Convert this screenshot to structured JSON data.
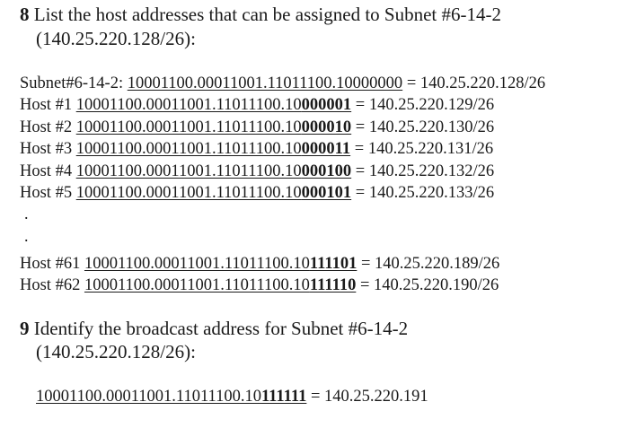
{
  "q8": {
    "number": "8",
    "title": " List the host addresses that can be assigned to Subnet #6-14-2",
    "subtitle": "(140.25.220.128/26):"
  },
  "subnet_line": {
    "label": "Subnet#6-14-2: ",
    "binary_plain": "10001100.00011001.11011100.10000000",
    "binary_bold": "",
    "result": " = 140.25.220.128/26"
  },
  "hosts": [
    {
      "label": "Host #1 ",
      "binary_plain": "10001100.00011001.11011100.10",
      "binary_bold": "000001",
      "result": " = 140.25.220.129/26"
    },
    {
      "label": "Host #2 ",
      "binary_plain": "10001100.00011001.11011100.10",
      "binary_bold": "000010",
      "result": " = 140.25.220.130/26"
    },
    {
      "label": "Host #3 ",
      "binary_plain": "10001100.00011001.11011100.10",
      "binary_bold": "000011",
      "result": " = 140.25.220.131/26"
    },
    {
      "label": "Host #4 ",
      "binary_plain": "10001100.00011001.11011100.10",
      "binary_bold": "000100",
      "result": " = 140.25.220.132/26"
    },
    {
      "label": "Host #5 ",
      "binary_plain": "10001100.00011001.11011100.10",
      "binary_bold": "000101",
      "result": " = 140.25.220.133/26"
    }
  ],
  "ellipsis": [
    ".",
    "."
  ],
  "hosts_end": [
    {
      "label": "Host #61 ",
      "binary_plain": "10001100.00011001.11011100.10",
      "binary_bold": "111101",
      "result": " = 140.25.220.189/26"
    },
    {
      "label": "Host #62 ",
      "binary_plain": "10001100.00011001.11011100.10",
      "binary_bold": "111110",
      "result": " = 140.25.220.190/26"
    }
  ],
  "q9": {
    "number": "9",
    "title": " Identify the broadcast address for Subnet #6-14-2",
    "subtitle": "(140.25.220.128/26):"
  },
  "broadcast": {
    "binary_plain": "10001100.00011001.11011100.10",
    "binary_bold": "111111",
    "result": " = 140.25.220.191"
  }
}
